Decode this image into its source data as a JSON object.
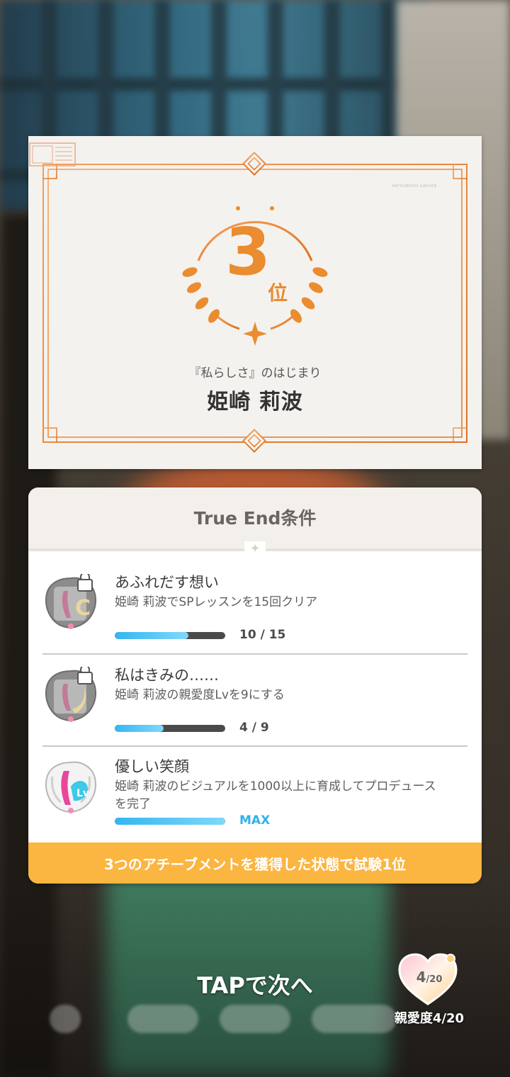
{
  "certificate": {
    "rank_number": "3",
    "rank_suffix": "位",
    "subtitle": "『私らしさ』のはじまり",
    "name": "姫崎 莉波",
    "school_logo_text": "HATSUBOSHI GAKUEN"
  },
  "conditions": {
    "title": "True End条件",
    "items": [
      {
        "title": "あふれだす想い",
        "description": "姫崎 莉波でSPレッスンを15回クリア",
        "progress": 0.667,
        "progress_text": "10 / 15",
        "badge": "locked-badge-icon"
      },
      {
        "title": "私はきみの……",
        "description": "姫崎 莉波の親愛度Lvを9にする",
        "progress": 0.444,
        "progress_text": "4 / 9",
        "badge": "locked-badge-icon"
      },
      {
        "title": "優しい笑顔",
        "description": "姫崎 莉波のビジュアルを1000以上に育成してプロデュースを完了",
        "progress": 1.0,
        "progress_text": "MAX",
        "badge": "unlocked-badge-icon"
      }
    ],
    "footer": "3つのアチーブメントを獲得した状態で試験1位"
  },
  "tap_hint": "TAPで次へ",
  "affection": {
    "value": "4",
    "max": "/20",
    "label": "親愛度4/20"
  },
  "colors": {
    "accent_orange": "#ea8c2f",
    "progress_blue": "#34b6f0",
    "footer_yellow": "#fbb541"
  }
}
